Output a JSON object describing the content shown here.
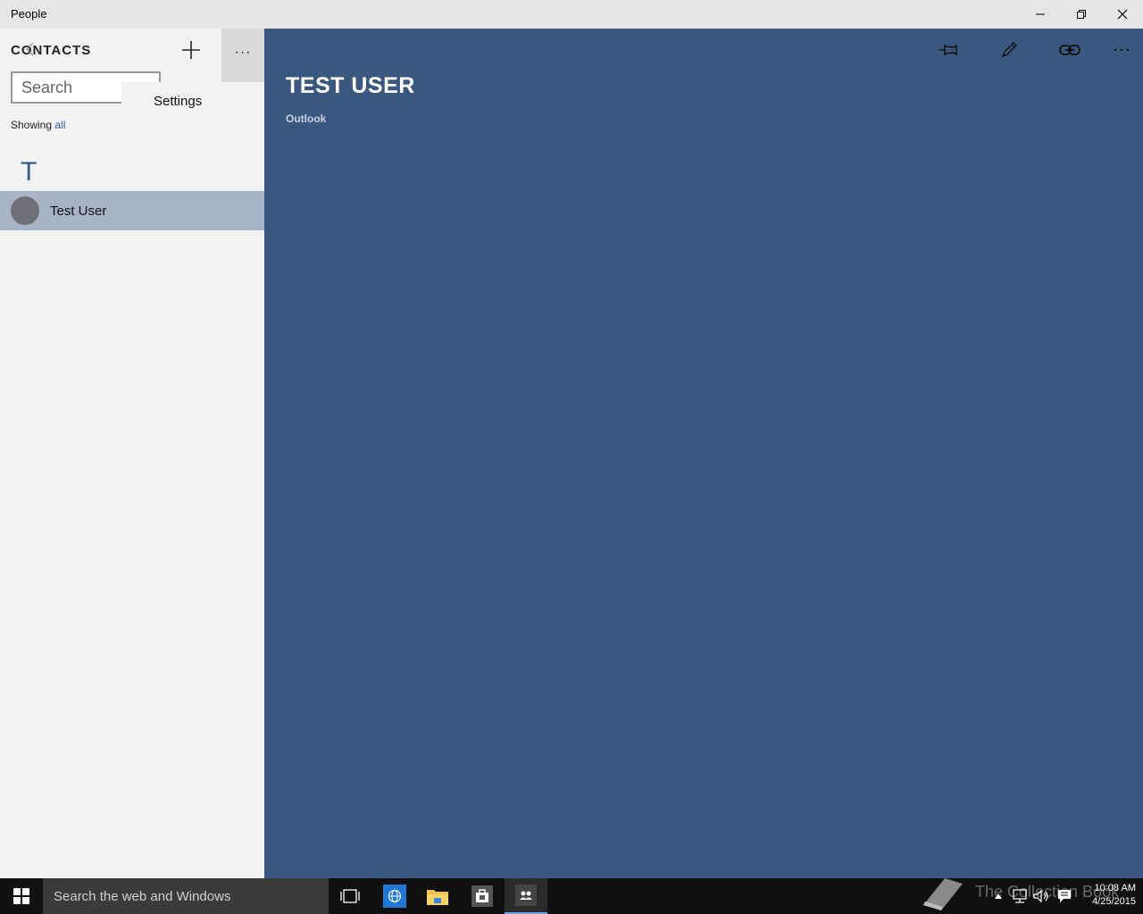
{
  "window": {
    "title": "People"
  },
  "left_pane": {
    "header": "CONTACTS",
    "search": {
      "placeholder": "Search",
      "value": ""
    },
    "menu": {
      "settings_label": "Settings"
    },
    "filter": {
      "prefix": "Showing",
      "link": "all"
    },
    "groups": [
      {
        "letter": "T",
        "contacts": [
          {
            "name": "Test User"
          }
        ]
      }
    ]
  },
  "detail": {
    "name": "TEST USER",
    "source": "Outlook",
    "toolbar": [
      "pin-icon",
      "edit-icon",
      "link-icon",
      "more-icon"
    ]
  },
  "taskbar": {
    "search_text": "Search the web and Windows",
    "watermark": "The Collection Book",
    "time": "10:08 AM",
    "date": "4/25/2015"
  },
  "colors": {
    "detail_background": "#3a577f",
    "selected_row": "#a8b4c6",
    "accent_link": "#2d5b9e"
  }
}
